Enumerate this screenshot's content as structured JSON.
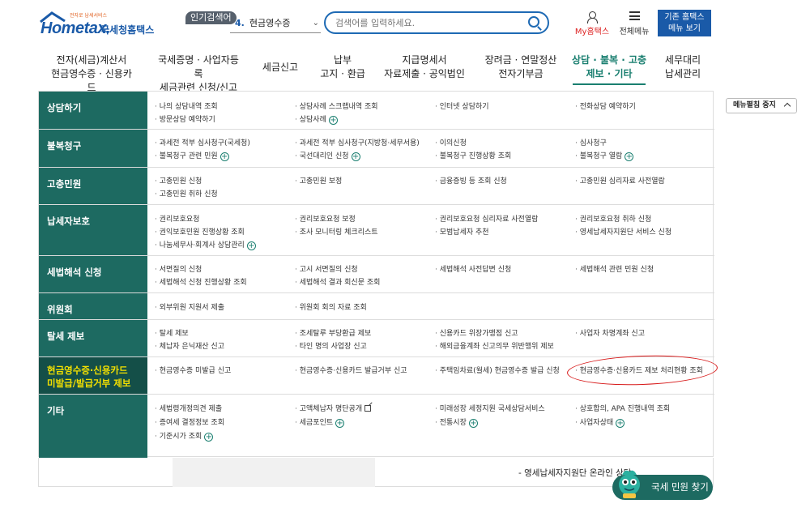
{
  "header": {
    "logo_word": "Hometax.",
    "logo_kr": "국세청홈택스",
    "logo_tag": "전자로 납세서비스",
    "popular_label": "인기검색어",
    "popular_rank": "4.",
    "popular_term": "현금영수증",
    "search_placeholder": "검색어를 입력하세요.",
    "myhome_label": "My홈택스",
    "menu_all_label": "전체메뉴",
    "basic_home_line1": "기존 홈택스",
    "basic_home_line2": "메뉴 보기"
  },
  "gnb": [
    {
      "line1": "전자(세금)계산서",
      "line2": "현금영수증 · 신용카드"
    },
    {
      "line1": "국세증명 · 사업자등록",
      "line2": "세금관련 신청/신고"
    },
    {
      "line1": "세금신고",
      "line2": ""
    },
    {
      "line1": "납부",
      "line2": "고지 · 환급"
    },
    {
      "line1": "지급명세서",
      "line2": "자료제출 · 공익법인"
    },
    {
      "line1": "장려금 · 연말정산",
      "line2": "전자기부금"
    },
    {
      "line1": "상담 · 불복 · 고충",
      "line2": "제보 · 기타"
    },
    {
      "line1": "세무대리",
      "line2": "납세관리"
    }
  ],
  "menu_close_label": "메뉴펼침 중지",
  "rows": [
    {
      "category": "상담하기",
      "links": [
        {
          "text": "나의 상담내역 조회"
        },
        {
          "text": "상담사례 스크랩내역 조회"
        },
        {
          "text": "인터넷 상담하기"
        },
        {
          "text": "전화상담 예약하기"
        },
        {
          "text": "방문상담 예약하기"
        },
        {
          "text": "상담사례"
        }
      ]
    },
    {
      "category": "불복청구",
      "links": [
        {
          "text": "과세전 적부 심사청구(국세청)"
        },
        {
          "text": "과세전 적부 심사청구(지방청·세무서용)"
        },
        {
          "text": "이의신청"
        },
        {
          "text": "심사청구"
        },
        {
          "text": "불복청구 관련 민원"
        },
        {
          "text": "국선대리인 신청"
        },
        {
          "text": "불복청구 진행상황 조회"
        },
        {
          "text": "불복청구 열람"
        }
      ]
    },
    {
      "category": "고충민원",
      "links": [
        {
          "text": "고충민원 신청"
        },
        {
          "text": "고충민원 보정"
        },
        {
          "text": "금융증빙 등 조회 신청"
        },
        {
          "text": "고충민원 심리자료 사전열람"
        },
        {
          "text": "고충민원 취하 신청"
        }
      ]
    },
    {
      "category": "납세자보호",
      "links": [
        {
          "text": "권리보호요청"
        },
        {
          "text": "권리보호요청 보정"
        },
        {
          "text": "권리보호요청 심리자료 사전열람"
        },
        {
          "text": "권리보호요청 취하 신청"
        },
        {
          "text": "권익보호민원 진행상황 조회"
        },
        {
          "text": "조사 모니터링 체크리스트"
        },
        {
          "text": "모범납세자 추천"
        },
        {
          "text": "영세납세자지원단 서비스 신청"
        },
        {
          "text": "나눔세무사·회계사 상담관리"
        }
      ]
    },
    {
      "category": "세법해석 신청",
      "links": [
        {
          "text": "서면질의 신청"
        },
        {
          "text": "고시 서면질의 신청"
        },
        {
          "text": "세법해석 사전답변 신청"
        },
        {
          "text": "세법해석 관련 민원 신청"
        },
        {
          "text": "세법해석 신청 진행상황 조회"
        },
        {
          "text": "세법해석 결과 회신문 조회"
        }
      ]
    },
    {
      "category": "위원회",
      "links": [
        {
          "text": "외부위원 지원서 제출"
        },
        {
          "text": "위원회 회의 자료 조회"
        }
      ]
    },
    {
      "category": "탈세 제보",
      "links": [
        {
          "text": "탈세 제보"
        },
        {
          "text": "조세탈루 부당환급 제보"
        },
        {
          "text": "신용카드 위장가맹점 신고"
        },
        {
          "text": "사업자 차명계좌 신고"
        },
        {
          "text": "체납자 은닉재산 신고"
        },
        {
          "text": "타인 명의 사업장 신고"
        },
        {
          "text": "해외금융계좌 신고의무 위반행위 제보"
        }
      ]
    },
    {
      "category_line1": "현금영수증·신용카드",
      "category_line2": "미발급/발급거부 제보",
      "links": [
        {
          "text": "현금영수증 미발급 신고"
        },
        {
          "text": "현금영수증·신용카드 발급거부 신고"
        },
        {
          "text": "주택임차료(월세) 현금영수증 발급 신청"
        },
        {
          "text": "현금영수증·신용카드 제보 처리현황 조회"
        }
      ]
    },
    {
      "category": "기타",
      "links": [
        {
          "text": "세법령개정의견 제출"
        },
        {
          "text": "고액체납자 명단공개"
        },
        {
          "text": "미래성장 세정지원 국세상담서비스"
        },
        {
          "text": "상호합의, APA 진행내역 조회"
        },
        {
          "text": "증여세 결정정보 조회"
        },
        {
          "text": "세금포인트"
        },
        {
          "text": "전통시장"
        },
        {
          "text": "사업자상태"
        },
        {
          "text": "기준시가 조회"
        }
      ]
    }
  ],
  "below": {
    "cut_left": "",
    "cut_right": "",
    "item": "- 영세납세자지원단 온라인 상담"
  },
  "find_button": "국세 민원 찾기"
}
